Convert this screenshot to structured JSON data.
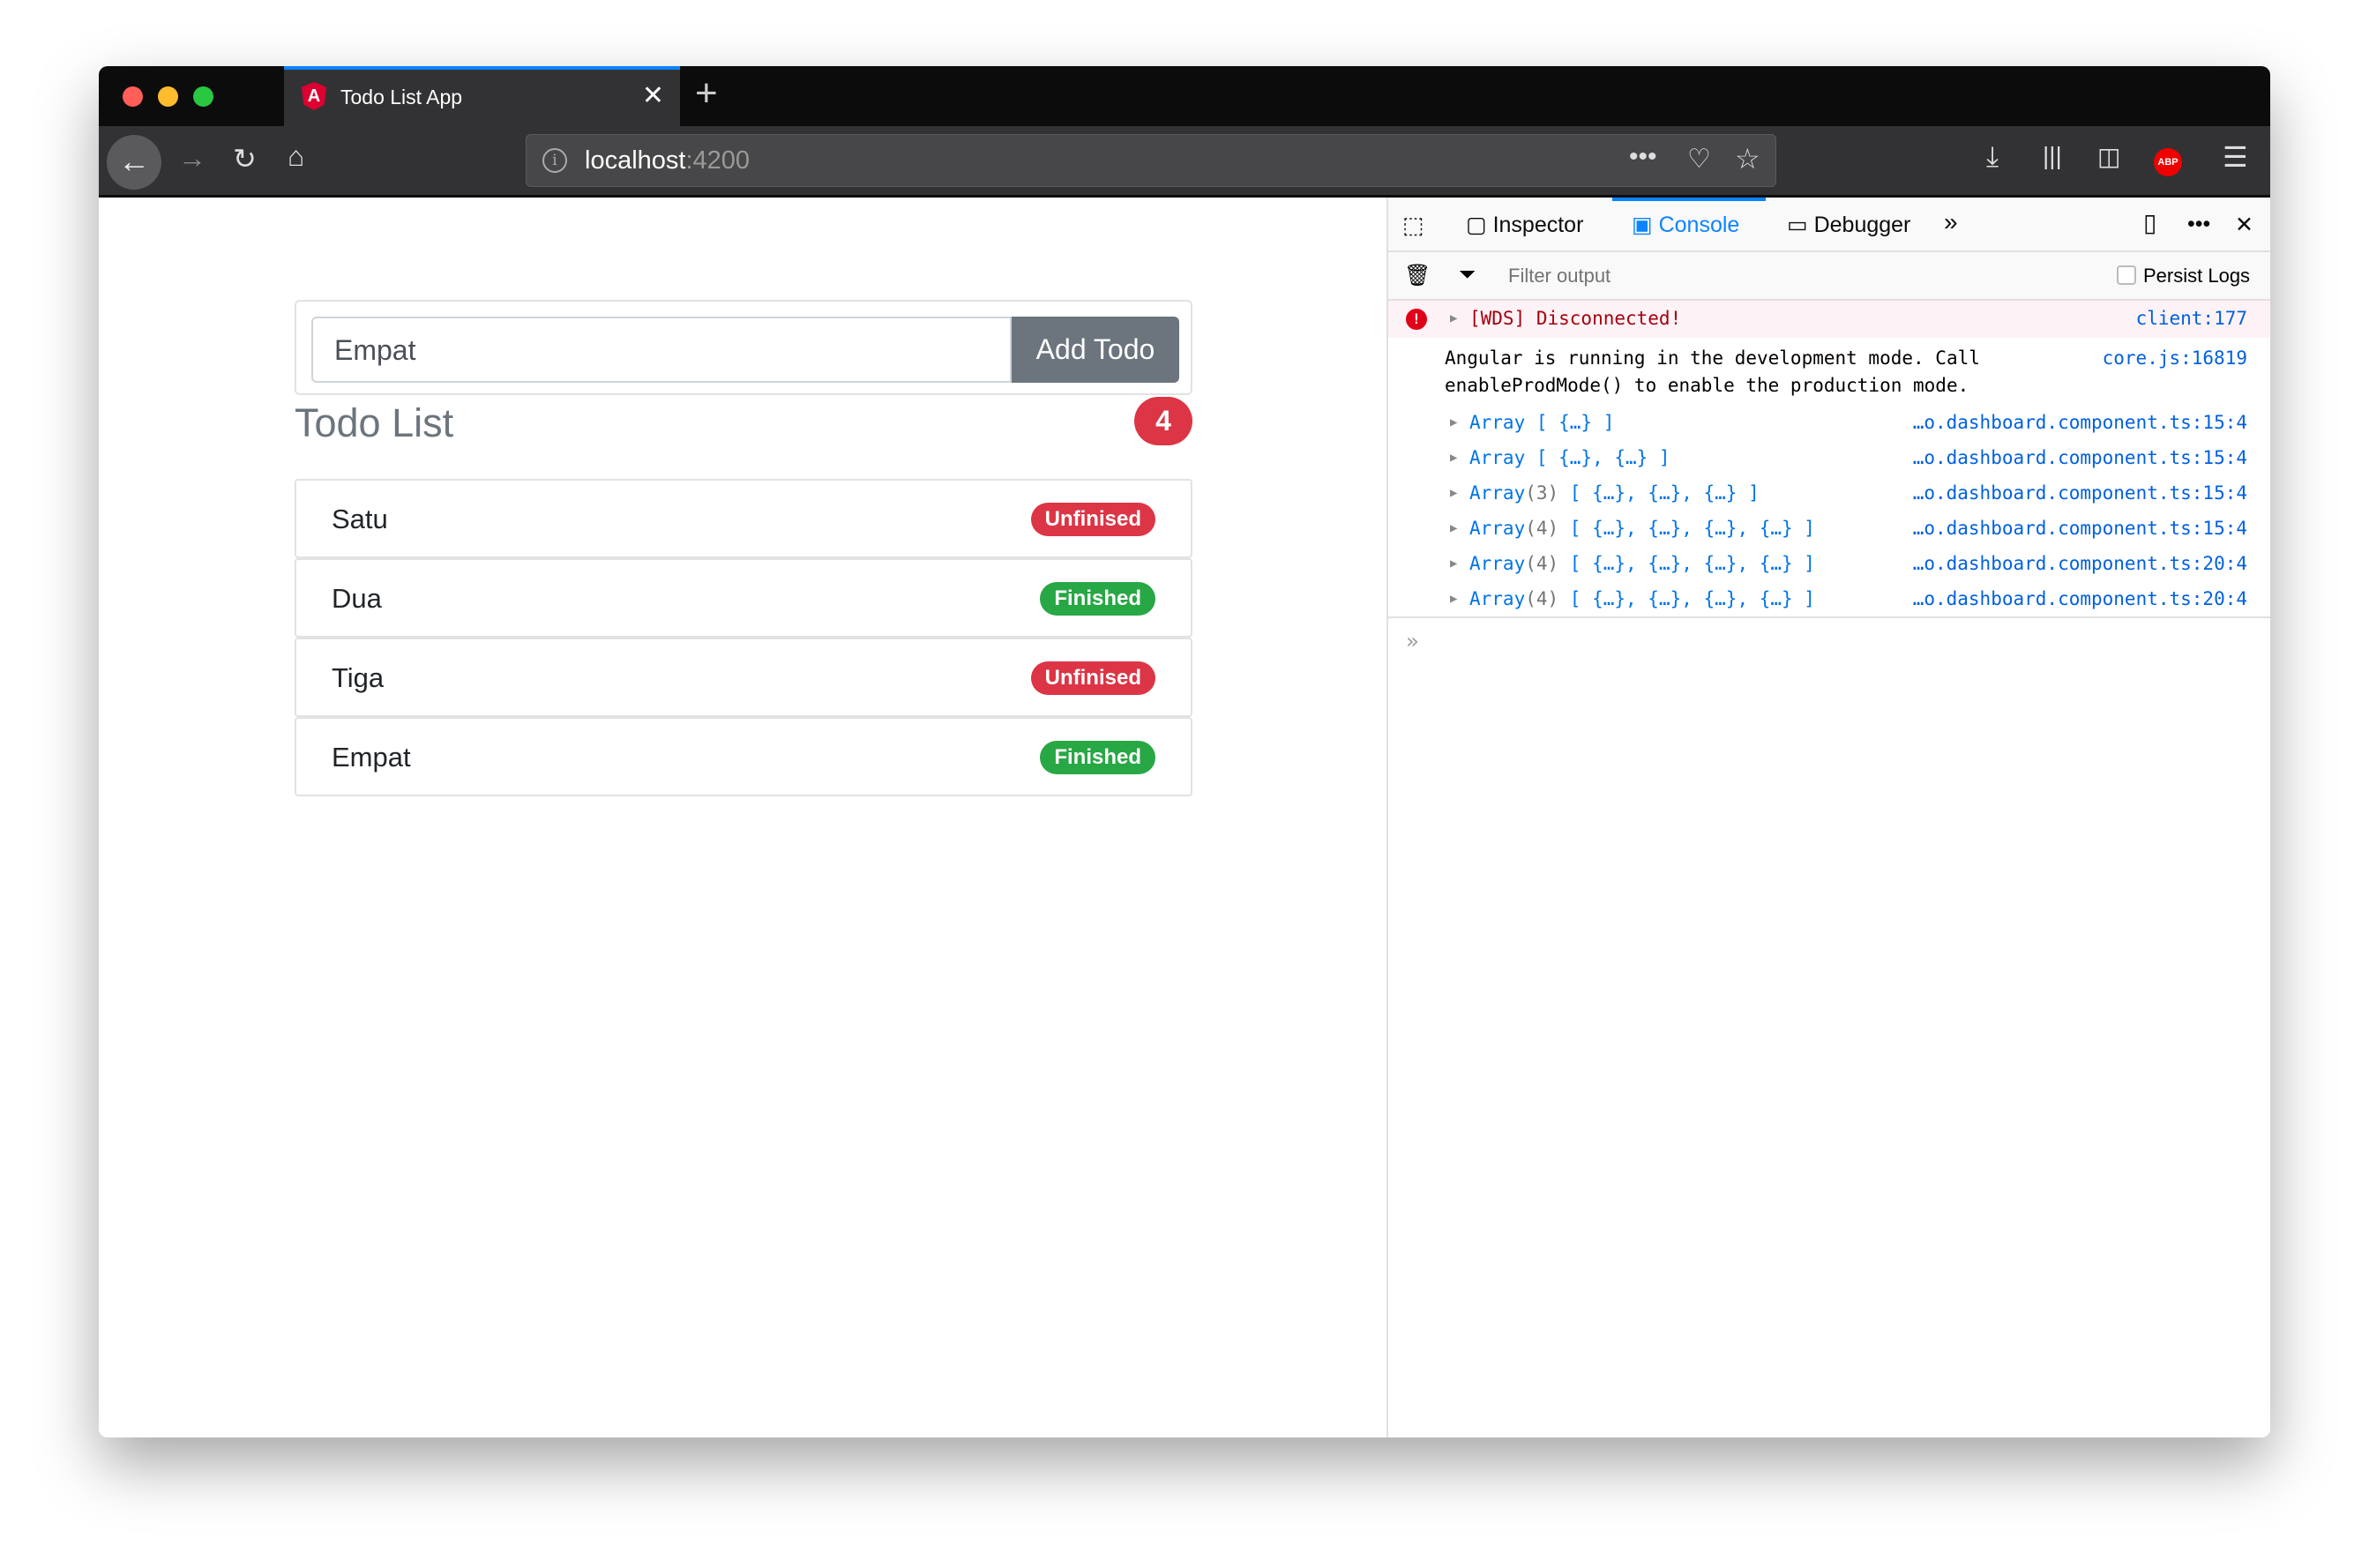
{
  "browser": {
    "tab_title": "Todo List App",
    "url_host": "localhost",
    "url_port": ":4200",
    "abp_label": "ABP",
    "accent": "#0a84ff"
  },
  "app": {
    "input_value": "Empat",
    "add_button": "Add Todo",
    "heading": "Todo List",
    "count": "4",
    "todos": [
      {
        "name": "Satu",
        "status": "Unfinised",
        "color": "#dc3545"
      },
      {
        "name": "Dua",
        "status": "Finished",
        "color": "#28a745"
      },
      {
        "name": "Tiga",
        "status": "Unfinised",
        "color": "#dc3545"
      },
      {
        "name": "Empat",
        "status": "Finished",
        "color": "#28a745"
      }
    ]
  },
  "devtools": {
    "tabs": [
      "Inspector",
      "Console",
      "Debugger"
    ],
    "active_tab": "Console",
    "filter_placeholder": "Filter output",
    "persist_logs": "Persist Logs",
    "messages": [
      {
        "text": "[WDS] Disconnected!",
        "source": "client:177",
        "level": "error"
      },
      {
        "line1": "Angular is running in the development mode. Call",
        "line2": "enableProdMode() to enable the production mode.",
        "source": "core.js:16819"
      },
      {
        "head": "Array",
        "body": " [ {…} ]",
        "source": "…o.dashboard.component.ts:15:4"
      },
      {
        "head": "Array",
        "body": " [ {…}, {…} ]",
        "source": "…o.dashboard.component.ts:15:4"
      },
      {
        "head": "Array",
        "len": "(3)",
        "body": " [ {…}, {…}, {…} ]",
        "source": "…o.dashboard.component.ts:15:4"
      },
      {
        "head": "Array",
        "len": "(4)",
        "body": " [ {…}, {…}, {…}, {…} ]",
        "source": "…o.dashboard.component.ts:15:4"
      },
      {
        "head": "Array",
        "len": "(4)",
        "body": " [ {…}, {…}, {…}, {…} ]",
        "source": "…o.dashboard.component.ts:20:4"
      },
      {
        "head": "Array",
        "len": "(4)",
        "body": " [ {…}, {…}, {…}, {…} ]",
        "source": "…o.dashboard.component.ts:20:4"
      }
    ]
  }
}
